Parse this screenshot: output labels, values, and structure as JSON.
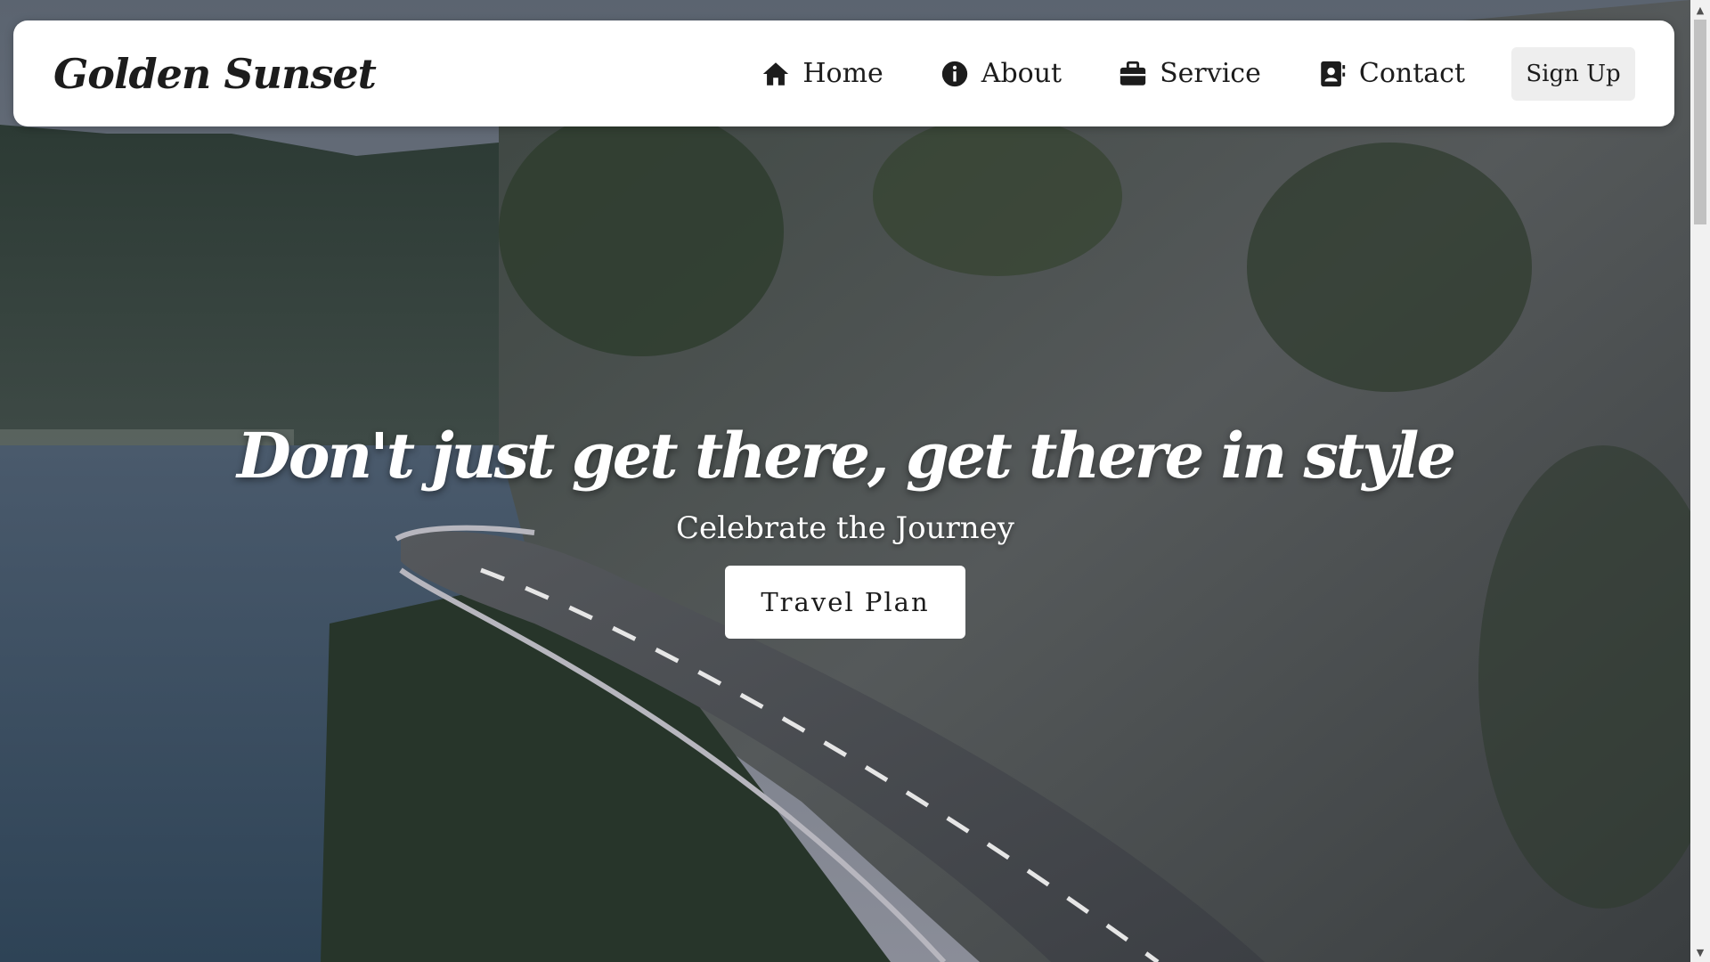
{
  "navbar": {
    "brand": "Golden Sunset",
    "links": [
      {
        "label": "Home",
        "icon": "home-icon"
      },
      {
        "label": "About",
        "icon": "info-icon"
      },
      {
        "label": "Service",
        "icon": "briefcase-icon"
      },
      {
        "label": "Contact",
        "icon": "contact-card-icon"
      }
    ],
    "signup_label": "Sign Up"
  },
  "hero": {
    "title": "Don't just get there, get there in style",
    "subtitle": "Celebrate the Journey",
    "button_label": "Travel Plan"
  },
  "colors": {
    "navbar_bg": "#ffffff",
    "text_dark": "#1c1c1c",
    "signup_bg": "#eeeeee",
    "hero_text": "#ffffff"
  }
}
